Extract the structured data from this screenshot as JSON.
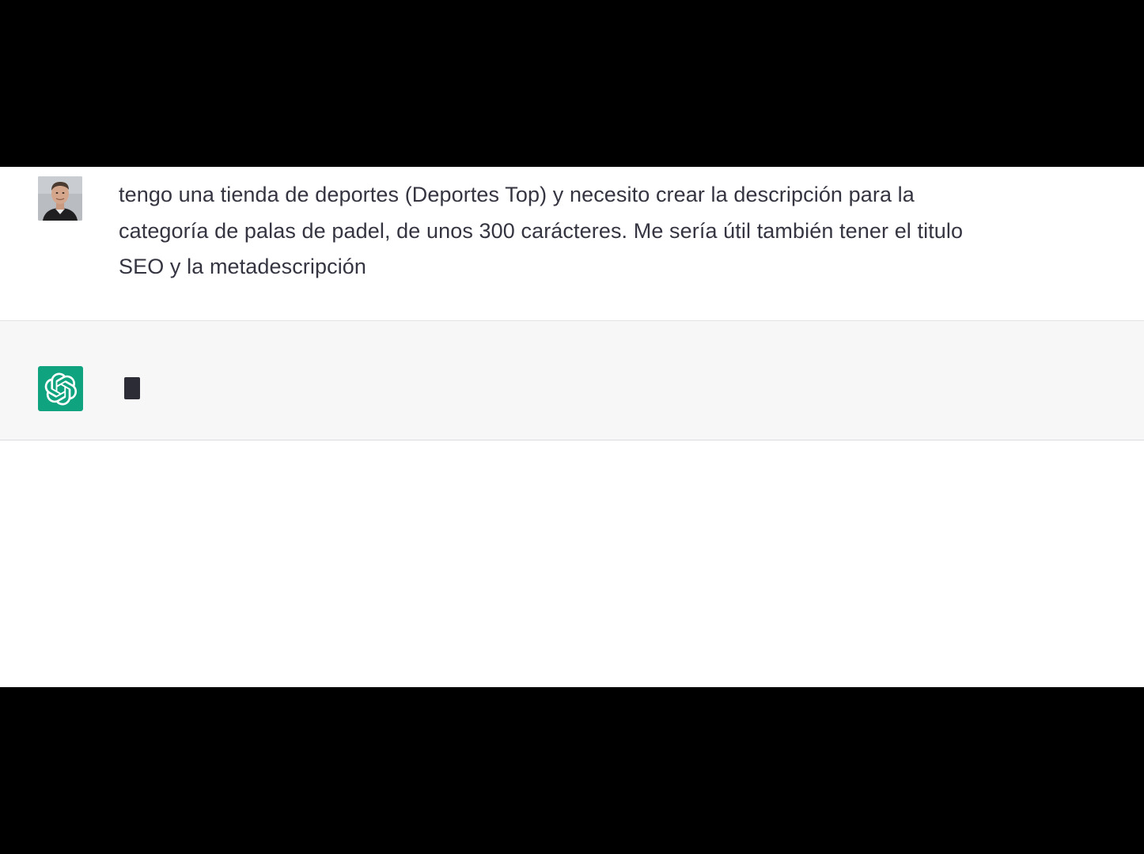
{
  "conversation": {
    "user_message": {
      "avatar_icon": "user-photo-avatar",
      "line1": "tengo una tienda de deportes (Deportes Top) y necesito crear la descripción para la",
      "line2": "categoría de palas de padel, de unos 300 carácteres. Me sería útil también tener el titulo",
      "line3": "SEO y la metadescripción"
    },
    "assistant_message": {
      "avatar_icon": "openai-logo-icon",
      "avatar_color": "#10a37f",
      "state": "typing-cursor"
    }
  },
  "colors": {
    "letterbox": "#000000",
    "user_bg": "#ffffff",
    "assistant_bg": "#f7f7f8",
    "text": "#343541"
  }
}
